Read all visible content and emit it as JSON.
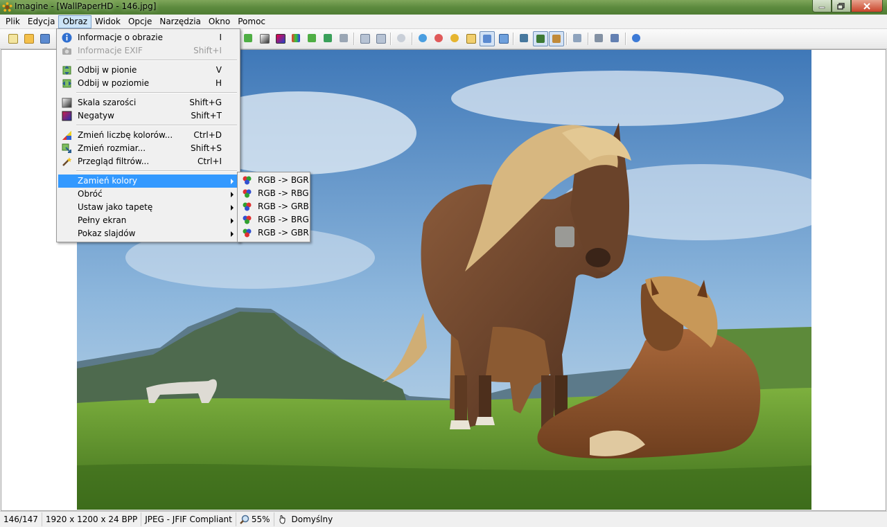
{
  "window": {
    "title": "Imagine - [WallPaperHD - 146.jpg]",
    "accent": "#5c8a3e"
  },
  "menubar": [
    "Plik",
    "Edycja",
    "Obraz",
    "Widok",
    "Opcje",
    "Narzędzia",
    "Okno",
    "Pomoc"
  ],
  "image_menu": [
    {
      "label": "Informacje o obrazie",
      "shortcut": "I",
      "icon": "info-icon",
      "enabled": true
    },
    {
      "label": "Informacje EXIF",
      "shortcut": "Shift+I",
      "icon": "camera-icon",
      "enabled": false
    },
    {
      "label": "Odbij w pionie",
      "shortcut": "V",
      "icon": "flip-vertical-icon",
      "enabled": true
    },
    {
      "label": "Odbij w poziomie",
      "shortcut": "H",
      "icon": "flip-horizontal-icon",
      "enabled": true
    },
    {
      "label": "Skala szarości",
      "shortcut": "Shift+G",
      "icon": "grayscale-icon",
      "enabled": true
    },
    {
      "label": "Negatyw",
      "shortcut": "Shift+T",
      "icon": "negative-icon",
      "enabled": true
    },
    {
      "label": "Zmień liczbę kolorów...",
      "shortcut": "Ctrl+D",
      "icon": "color-depth-icon",
      "enabled": true
    },
    {
      "label": "Zmień rozmiar...",
      "shortcut": "Shift+S",
      "icon": "resize-icon",
      "enabled": true
    },
    {
      "label": "Przegląd filtrów...",
      "shortcut": "Ctrl+I",
      "icon": "filter-wand-icon",
      "enabled": true
    },
    {
      "label": "Zamień kolory",
      "submenu": true,
      "highlighted": true
    },
    {
      "label": "Obróć",
      "submenu": true
    },
    {
      "label": "Ustaw jako tapetę",
      "submenu": true
    },
    {
      "label": "Pełny ekran",
      "submenu": true
    },
    {
      "label": "Pokaz slajdów",
      "submenu": true
    }
  ],
  "swap_colors_submenu": [
    "RGB -> BGR",
    "RGB -> RBG",
    "RGB -> GRB",
    "RGB -> BRG",
    "RGB -> GBR"
  ],
  "statusbar": {
    "position": "146/147",
    "dimensions": "1920 x 1200 x 24 BPP",
    "format": "JPEG - JFIF Compliant",
    "zoom": "55%",
    "mode": "Domyślny"
  }
}
